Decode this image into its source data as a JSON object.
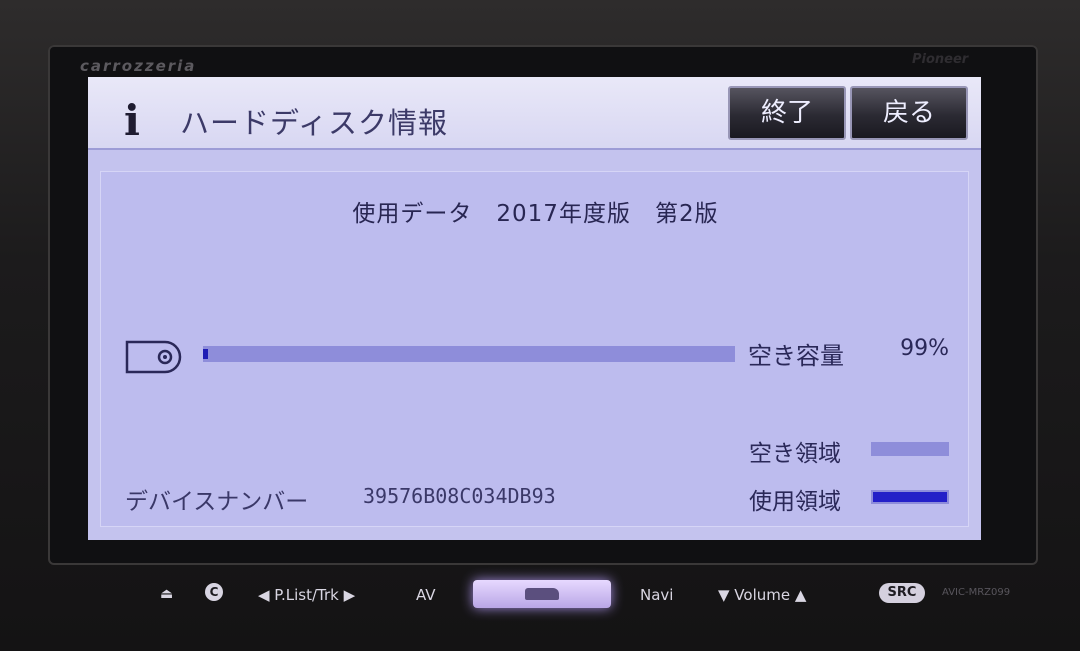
{
  "device": {
    "brand": "carrozzeria",
    "brand_right": "Pioneer",
    "model": "AVIC-MRZ099"
  },
  "header": {
    "icon": "info-icon",
    "title": "ハードディスク情報",
    "end_label": "終了",
    "back_label": "戻る"
  },
  "main": {
    "data_version": "使用データ　2017年度版　第2版",
    "free_capacity_label": "空き容量",
    "free_capacity_value": "99%",
    "free_fraction": 0.99,
    "legend_free_label": "空き領域",
    "legend_used_label": "使用領域",
    "serial_label": "デバイスナンバー",
    "serial_value": "39576B08C034DB93"
  },
  "hardware_buttons": {
    "eject": "⏏",
    "c_label": "C",
    "plist": "◀ P.List/Trk ▶",
    "av": "AV",
    "navi": "Navi",
    "volume": "▼  Volume  ▲",
    "src": "SRC"
  },
  "colors": {
    "screen_bg": "#c4c3ee",
    "free_bar": "#8e8dda",
    "used_bar": "#2420c8"
  }
}
